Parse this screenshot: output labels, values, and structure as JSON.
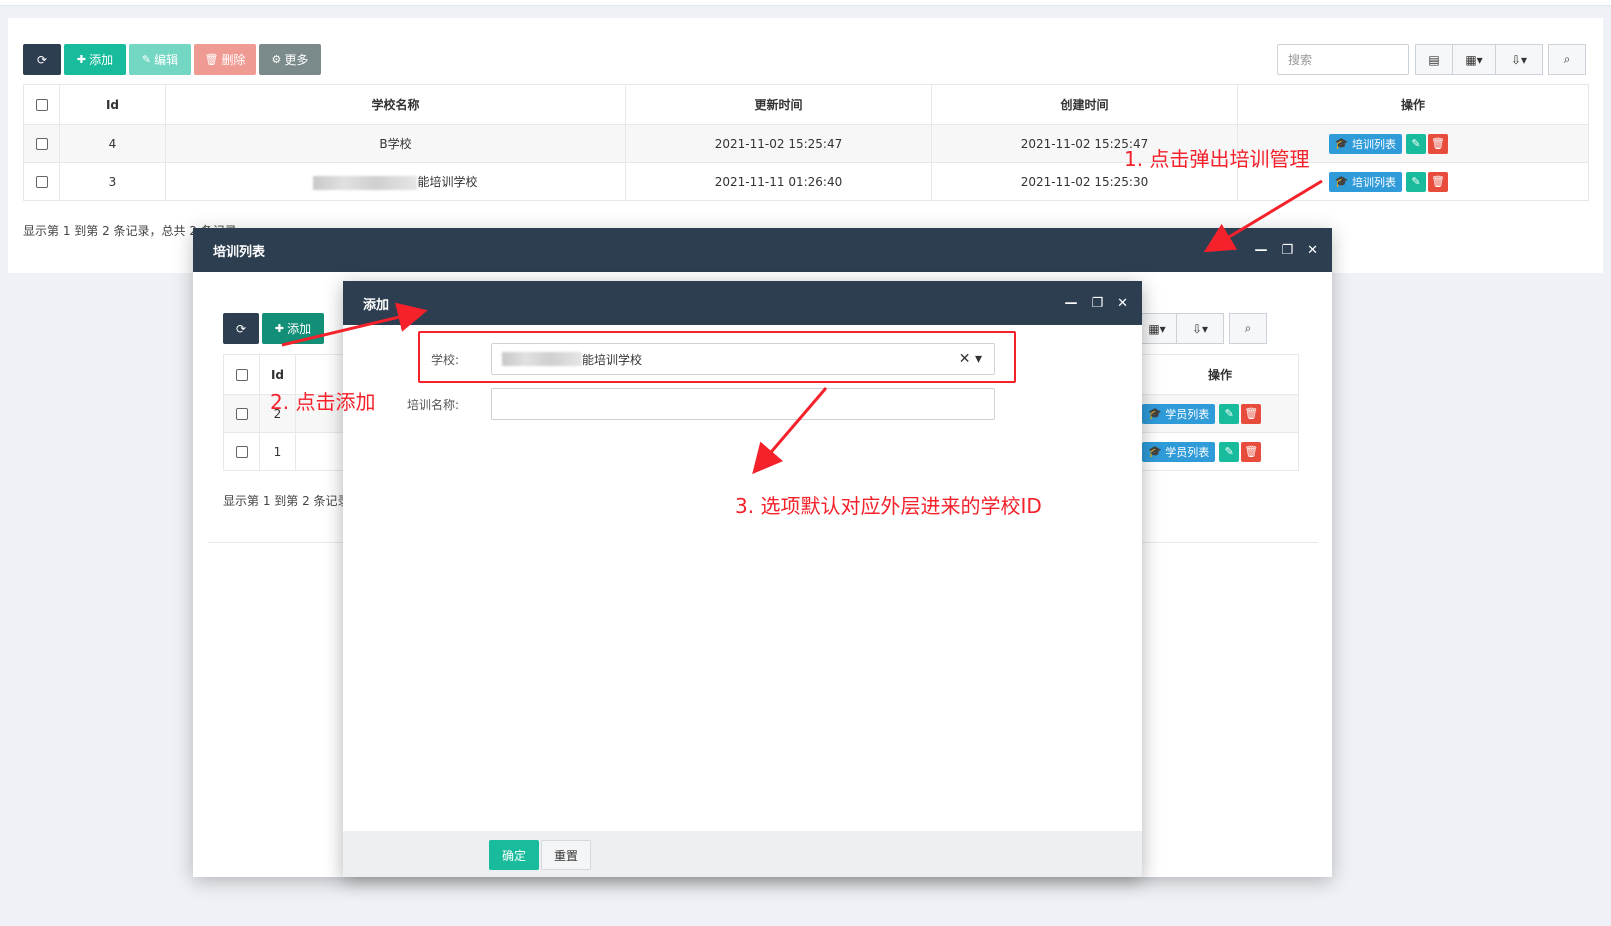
{
  "main": {
    "toolbar": {
      "refresh": "⟳",
      "add": "添加",
      "edit": "编辑",
      "delete": "删除",
      "more": "更多"
    },
    "search_placeholder": "搜索",
    "columns": [
      "Id",
      "学校名称",
      "更新时间",
      "创建时间",
      "操作"
    ],
    "rows": [
      {
        "id": "4",
        "name": "B学校",
        "updated": "2021-11-02 15:25:47",
        "created": "2021-11-02 15:25:47",
        "action": "培训列表"
      },
      {
        "id": "3",
        "name": "能培训学校",
        "updated": "2021-11-11 01:26:40",
        "created": "2021-11-02 15:25:30",
        "action": "培训列表"
      }
    ],
    "footer": "显示第 1 到第 2 条记录，总共 2 条记录"
  },
  "layer1": {
    "title": "培训列表",
    "toolbar": {
      "add": "添加"
    },
    "columns": [
      "Id",
      "操作"
    ],
    "rows": [
      {
        "id": "2",
        "action": "学员列表"
      },
      {
        "id": "1",
        "action": "学员列表"
      }
    ],
    "footer": "显示第 1 到第 2 条记录"
  },
  "layer2": {
    "title": "添加",
    "school_label": "学校:",
    "school_value": "能培训学校",
    "training_label": "培训名称:",
    "training_value": "",
    "confirm": "确定",
    "reset": "重置"
  },
  "annotations": {
    "step1": "1. 点击弹出培训管理",
    "step2": "2. 点击添加",
    "step3": "3. 选项默认对应外层进来的学校ID",
    "color": "#f5212b"
  },
  "window_controls": {
    "minimize": "—",
    "maximize": "❐",
    "close": "✕"
  }
}
